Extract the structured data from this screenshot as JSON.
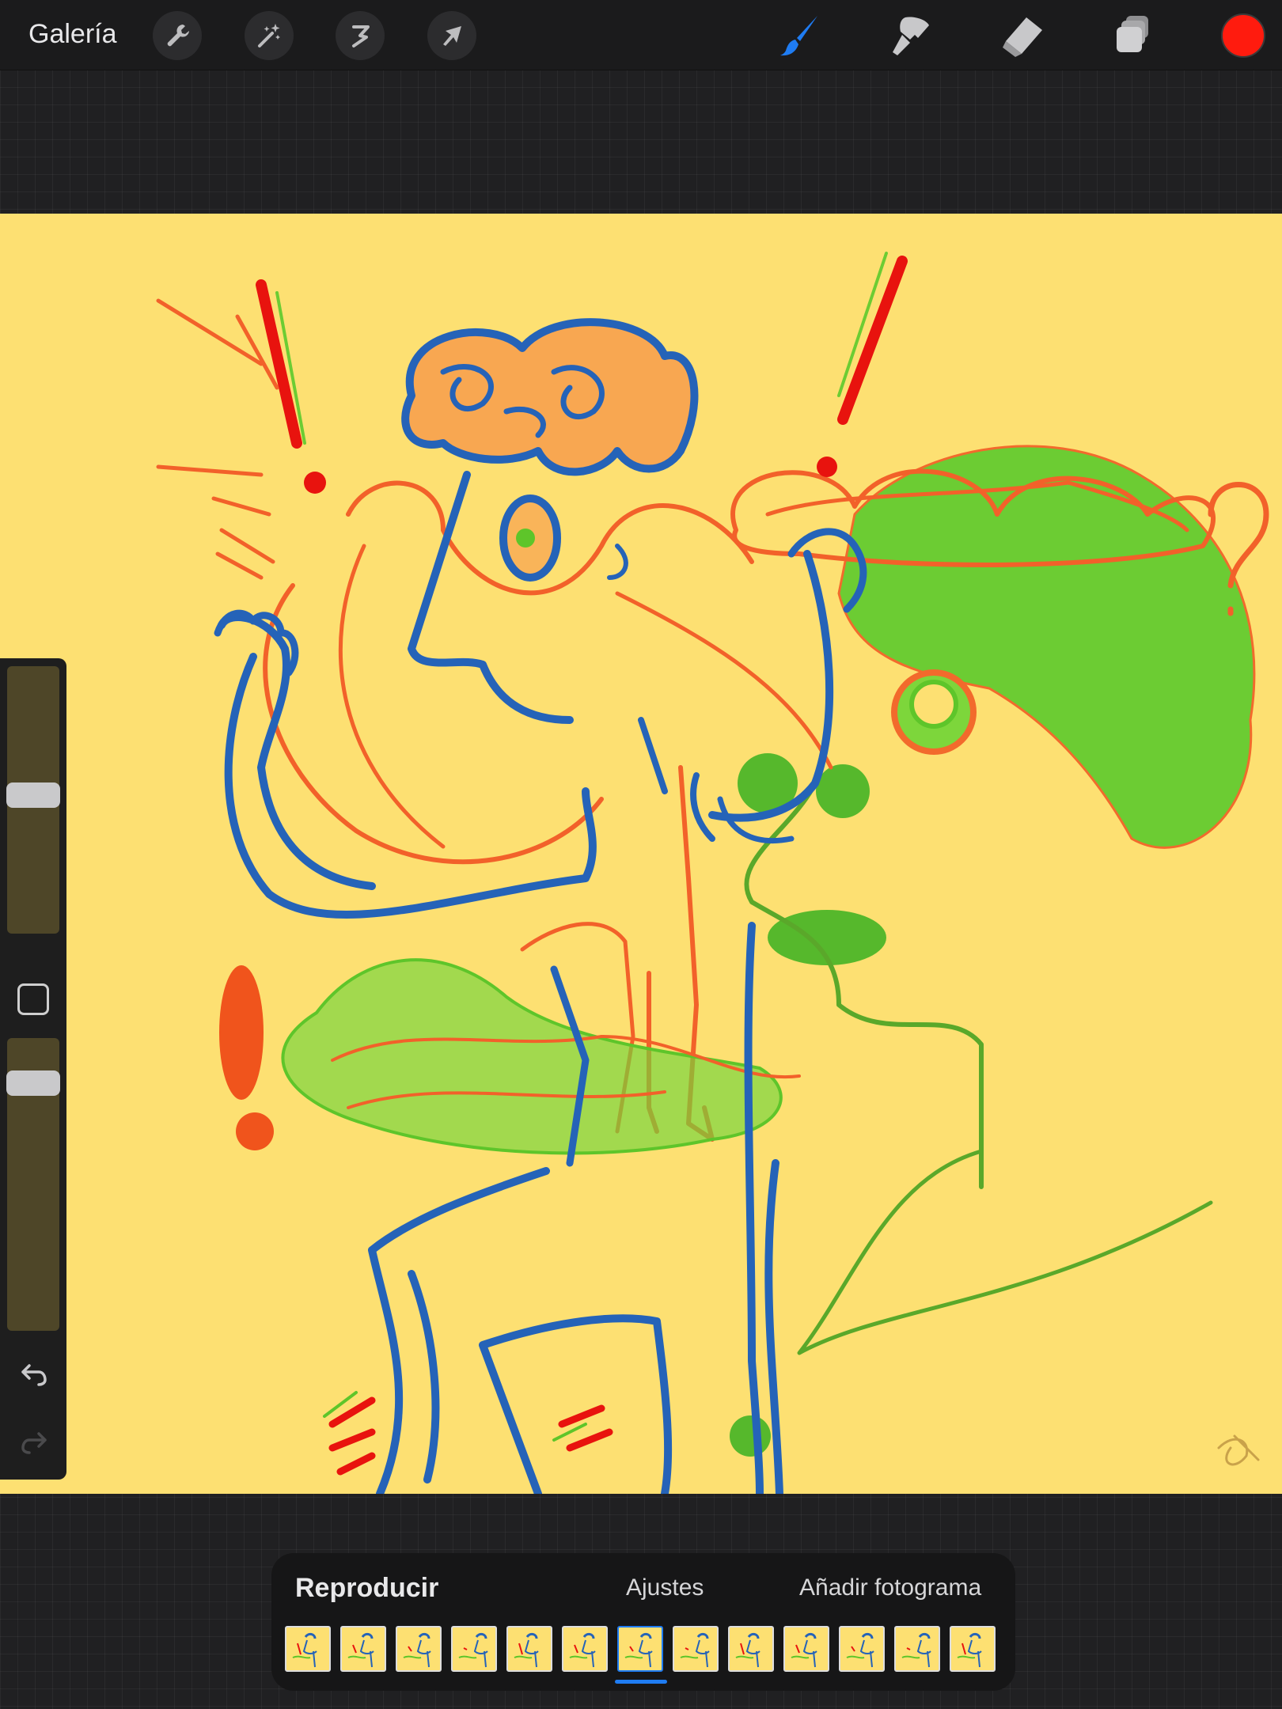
{
  "topbar": {
    "gallery_label": "Galería",
    "left_tools": [
      "wrench-icon",
      "magic-wand-icon",
      "selection-icon",
      "transform-arrow-icon"
    ],
    "right_tools": [
      "brush-icon",
      "smudge-icon",
      "eraser-icon",
      "layers-icon"
    ],
    "active_tool": "brush-icon",
    "active_tool_color": "#1f7cf2",
    "current_color": "#ff1b0e"
  },
  "canvas": {
    "background_color": "#fde072",
    "stroke_colors": {
      "blue": "#2563b8",
      "orange": "#f2612a",
      "green": "#5ec52a",
      "red": "#e8130e"
    }
  },
  "sidebar": {
    "brush_size_level": 0.52,
    "opacity_level": 0.88,
    "icons": [
      "square-modify-icon",
      "undo-icon",
      "redo-icon"
    ]
  },
  "timeline": {
    "play_label": "Reproducir",
    "settings_label": "Ajustes",
    "add_frame_label": "Añadir fotograma",
    "frame_count": 13,
    "selected_frame": 7,
    "selected_color": "#1f7cf2"
  }
}
